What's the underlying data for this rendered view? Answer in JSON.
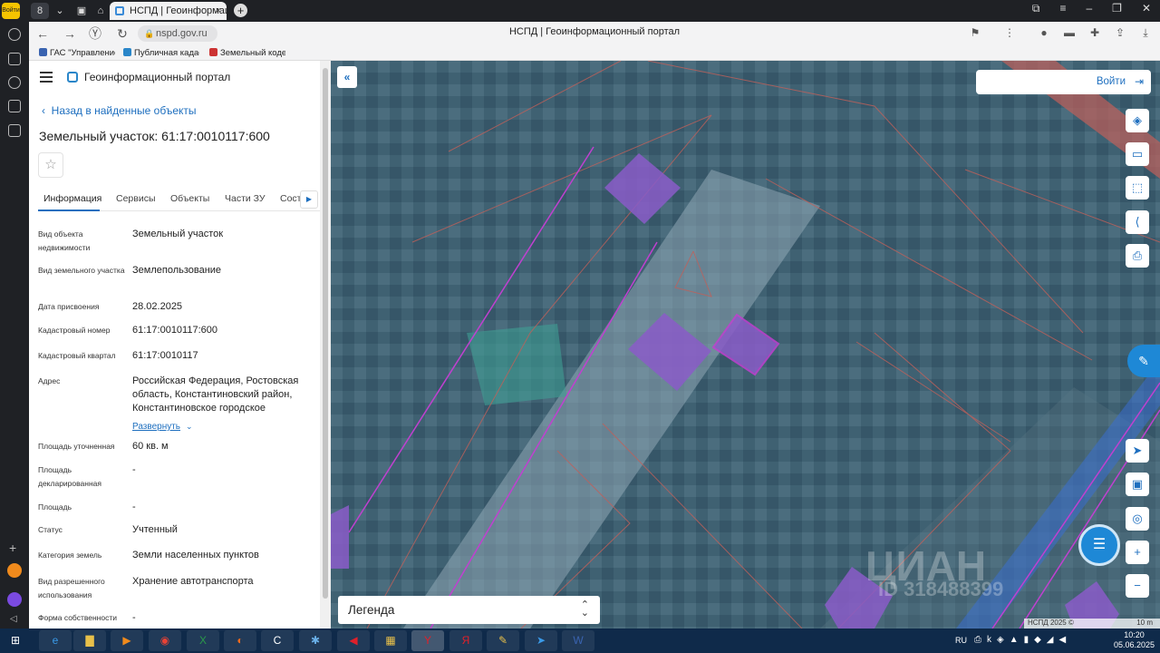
{
  "browser": {
    "tab_title": "НСПД | Геоинформационн",
    "tab_count": "8",
    "url": "nspd.gov.ru",
    "page_title": "НСПД | Геоинформационный портал",
    "bookmarks": [
      "ГАС \"Управление",
      "Публичная кадас",
      "Земельный кодек"
    ],
    "sidebar_top_label": "Войти"
  },
  "panel": {
    "portal_name": "Геоинформационный портал",
    "back_label": "Назад в найденные объекты",
    "object_title": "Земельный участок: 61:17:0010117:600",
    "tabs": [
      "Информация",
      "Сервисы",
      "Объекты",
      "Части ЗУ",
      "Сост"
    ],
    "rows": [
      {
        "key": "Вид объекта недвижимости",
        "value": "Земельный участок"
      },
      {
        "key": "Вид земельного участка",
        "value": "Землепользование"
      },
      {
        "key": "Дата присвоения",
        "value": "28.02.2025"
      },
      {
        "key": "Кадастровый номер",
        "value": "61:17:0010117:600"
      },
      {
        "key": "Кадастровый квартал",
        "value": "61:17:0010117"
      },
      {
        "key": "Адрес",
        "value": "Российская Федерация, Ростовская область, Константиновский район, Константиновское городское"
      },
      {
        "key": "Площадь уточненная",
        "value": "60 кв. м"
      },
      {
        "key": "Площадь декларированная",
        "value": "-"
      },
      {
        "key": "Площадь",
        "value": "-"
      },
      {
        "key": "Статус",
        "value": "Учтенный"
      },
      {
        "key": "Категория земель",
        "value": "Земли населенных пунктов"
      },
      {
        "key": "Вид разрешенного использования",
        "value": "Хранение автотранспорта"
      },
      {
        "key": "Форма собственности",
        "value": "-"
      }
    ],
    "expand_label": "Развернуть"
  },
  "map": {
    "login_label": "Войти",
    "legend_label": "Легенда",
    "watermark": "ЦИАН",
    "watermark_id": "ID 318488399",
    "attribution": "НСПД 2025 ©",
    "scale": "10 m"
  },
  "taskbar": {
    "lang": "RU",
    "time": "10:20",
    "date": "05.06.2025"
  },
  "colors": {
    "accent": "#1e6fbf",
    "parcel_fill": "#8a5cc8",
    "parcel_stroke": "#c040d0",
    "boundary": "#c0605a"
  }
}
